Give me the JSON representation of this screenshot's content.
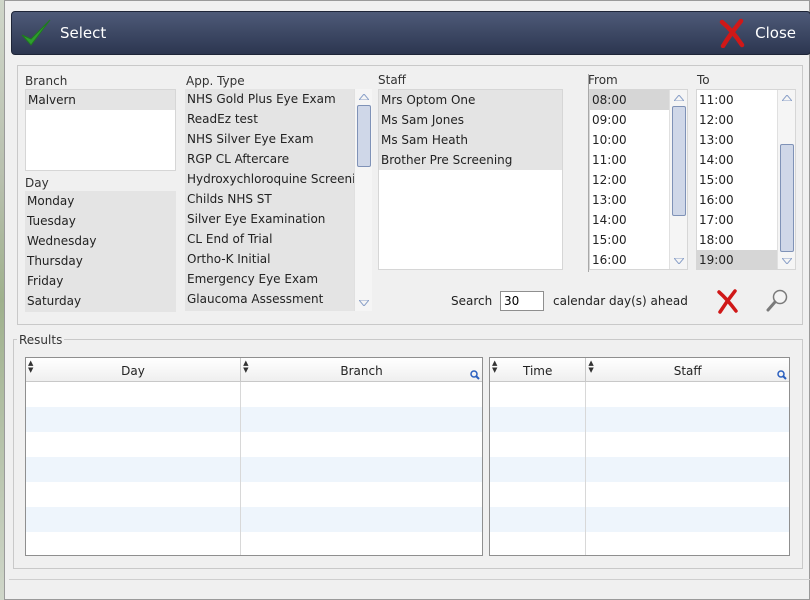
{
  "titlebar": {
    "select_label": "Select",
    "close_label": "Close"
  },
  "branch": {
    "label": "Branch",
    "items": [
      "Malvern"
    ]
  },
  "day": {
    "label": "Day",
    "items": [
      "Monday",
      "Tuesday",
      "Wednesday",
      "Thursday",
      "Friday",
      "Saturday"
    ]
  },
  "app_type": {
    "label": "App. Type",
    "items": [
      "NHS Gold Plus Eye Exam",
      "ReadEz test",
      "NHS Silver Eye Exam",
      "RGP CL Aftercare",
      "Hydroxychloroquine Screening",
      "Childs NHS ST",
      "Silver Eye Examination",
      "CL End of Trial",
      "Ortho-K Initial",
      "Emergency Eye Exam",
      "Glaucoma Assessment"
    ]
  },
  "staff": {
    "label": "Staff",
    "items": [
      "Mrs Optom One",
      "Ms Sam Jones",
      "Ms Sam Heath",
      "Brother Pre Screening"
    ]
  },
  "from": {
    "label": "From",
    "items": [
      "08:00",
      "09:00",
      "10:00",
      "11:00",
      "12:00",
      "13:00",
      "14:00",
      "15:00",
      "16:00"
    ],
    "selected": "08:00"
  },
  "to": {
    "label": "To",
    "items": [
      "11:00",
      "12:00",
      "13:00",
      "14:00",
      "15:00",
      "16:00",
      "17:00",
      "18:00",
      "19:00"
    ],
    "selected": "19:00"
  },
  "search": {
    "label": "Search",
    "value": "30",
    "suffix": "calendar day(s) ahead"
  },
  "results": {
    "label": "Results",
    "left_columns": [
      "Day",
      "Branch"
    ],
    "right_columns": [
      "Time",
      "Staff"
    ]
  },
  "colors": {
    "titlebar": "#2c3650",
    "check": "#2e9e2e",
    "cross": "#d01818",
    "selection": "#d6d6d6",
    "row_alt": "#eef5fc",
    "scroll_thumb": "#cfd7e8"
  }
}
